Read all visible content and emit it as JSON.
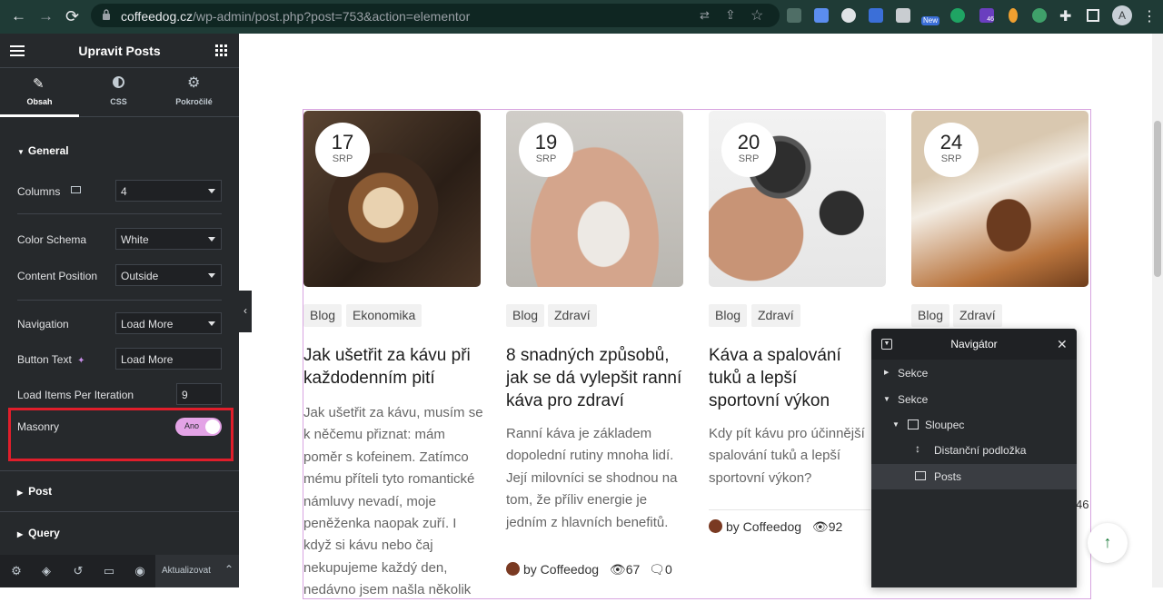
{
  "browser": {
    "url_domain": "coffeedog.cz",
    "url_path": "/wp-admin/post.php?post=753&action=elementor",
    "profile_initial": "A",
    "new_badge": "New",
    "ext_badge": "46"
  },
  "panel": {
    "title": "Upravit Posts",
    "tabs": [
      {
        "label": "Obsah"
      },
      {
        "label": "CSS"
      },
      {
        "label": "Pokročilé"
      }
    ],
    "general": {
      "heading": "General",
      "columns": {
        "label": "Columns",
        "value": "4"
      },
      "color_schema": {
        "label": "Color Schema",
        "value": "White"
      },
      "content_position": {
        "label": "Content Position",
        "value": "Outside"
      },
      "navigation": {
        "label": "Navigation",
        "value": "Load More"
      },
      "button_text": {
        "label": "Button Text",
        "value": "Load More"
      },
      "load_items": {
        "label": "Load Items Per Iteration",
        "value": "9"
      },
      "masonry": {
        "label": "Masonry",
        "value": "Ano"
      }
    },
    "sections": [
      {
        "label": "Post"
      },
      {
        "label": "Query"
      }
    ],
    "footer": {
      "update_label": "Aktualizovat"
    }
  },
  "posts": [
    {
      "day": "17",
      "month": "SRP",
      "tags": [
        "Blog",
        "Ekonomika"
      ],
      "title": "Jak ušetřit za kávu při každodenním pití",
      "excerpt": "Jak ušetřit za kávu, musím se k něčemu přiznat: mám poměr s kofeinem. Zatímco mému příteli tyto romantické námluvy nevadí, moje peněženka naopak zuří. I když si kávu nebo čaj nekupujeme každý den, nedávno jsem našla několik"
    },
    {
      "day": "19",
      "month": "SRP",
      "tags": [
        "Blog",
        "Zdraví"
      ],
      "title": "8 snadných způsobů, jak se dá vylepšit ranní káva pro zdraví",
      "excerpt": "Ranní káva je základem dopolední rutiny mnoha lidí. Její milovníci se shodnou na tom, že příliv energie je jedním z hlavních benefitů.",
      "author": "by Coffeedog",
      "views": "67",
      "comments": "0"
    },
    {
      "day": "20",
      "month": "SRP",
      "tags": [
        "Blog",
        "Zdraví"
      ],
      "title": "Káva a spalování tuků a lepší sportovní výkon",
      "excerpt": "Kdy pít kávu pro účinnější spalování tuků a lepší sportovní výkon?",
      "author": "by Coffeedog",
      "views": "92"
    },
    {
      "day": "24",
      "month": "SRP",
      "tags": [
        "Blog",
        "Zdraví"
      ],
      "partial_count": "46"
    }
  ],
  "navigator": {
    "title": "Navigátor",
    "items": [
      {
        "label": "Sekce"
      },
      {
        "label": "Sekce"
      },
      {
        "label": "Sloupec"
      },
      {
        "label": "Distanční podložka"
      },
      {
        "label": "Posts"
      }
    ]
  },
  "colors": {
    "panel_bg": "#26292c",
    "accent_toggle": "#e3a3e6",
    "highlight_red": "#e01e2b",
    "frame_pink": "#d8a4e0",
    "chrome_bg": "#1f3b36"
  }
}
